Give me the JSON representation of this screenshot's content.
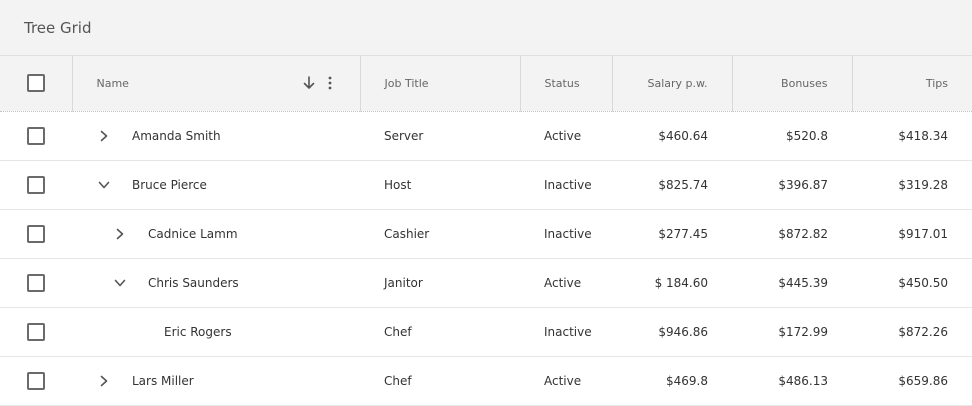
{
  "grid": {
    "title": "Tree Grid"
  },
  "columns": {
    "name": "Name",
    "job_title": "Job Title",
    "status": "Status",
    "salary": "Salary p.w.",
    "bonuses": "Bonuses",
    "tips": "Tips"
  },
  "rows": [
    {
      "name": "Amanda Smith",
      "job": "Server",
      "status": "Active",
      "salary": "$460.64",
      "bonuses": "$520.8",
      "tips": "$418.34",
      "level": 0,
      "toggle": "collapsed"
    },
    {
      "name": "Bruce Pierce",
      "job": "Host",
      "status": "Inactive",
      "salary": "$825.74",
      "bonuses": "$396.87",
      "tips": "$319.28",
      "level": 0,
      "toggle": "expanded"
    },
    {
      "name": "Cadnice Lamm",
      "job": "Cashier",
      "status": "Inactive",
      "salary": "$277.45",
      "bonuses": "$872.82",
      "tips": "$917.01",
      "level": 1,
      "toggle": "collapsed"
    },
    {
      "name": "Chris Saunders",
      "job": "Janitor",
      "status": "Active",
      "salary": "$ 184.60",
      "bonuses": "$445.39",
      "tips": "$450.50",
      "level": 1,
      "toggle": "expanded"
    },
    {
      "name": "Eric Rogers",
      "job": "Chef",
      "status": "Inactive",
      "salary": "$946.86",
      "bonuses": "$172.99",
      "tips": "$872.26",
      "level": 2,
      "toggle": "none"
    },
    {
      "name": "Lars Miller",
      "job": "Chef",
      "status": "Active",
      "salary": "$469.8",
      "bonuses": "$486.13",
      "tips": "$659.86",
      "level": 0,
      "toggle": "collapsed"
    }
  ],
  "icons": {
    "sort": "arrow-down-icon",
    "menu": "more-vertical-icon",
    "collapsed": "chevron-right-icon",
    "expanded": "chevron-down-icon"
  }
}
